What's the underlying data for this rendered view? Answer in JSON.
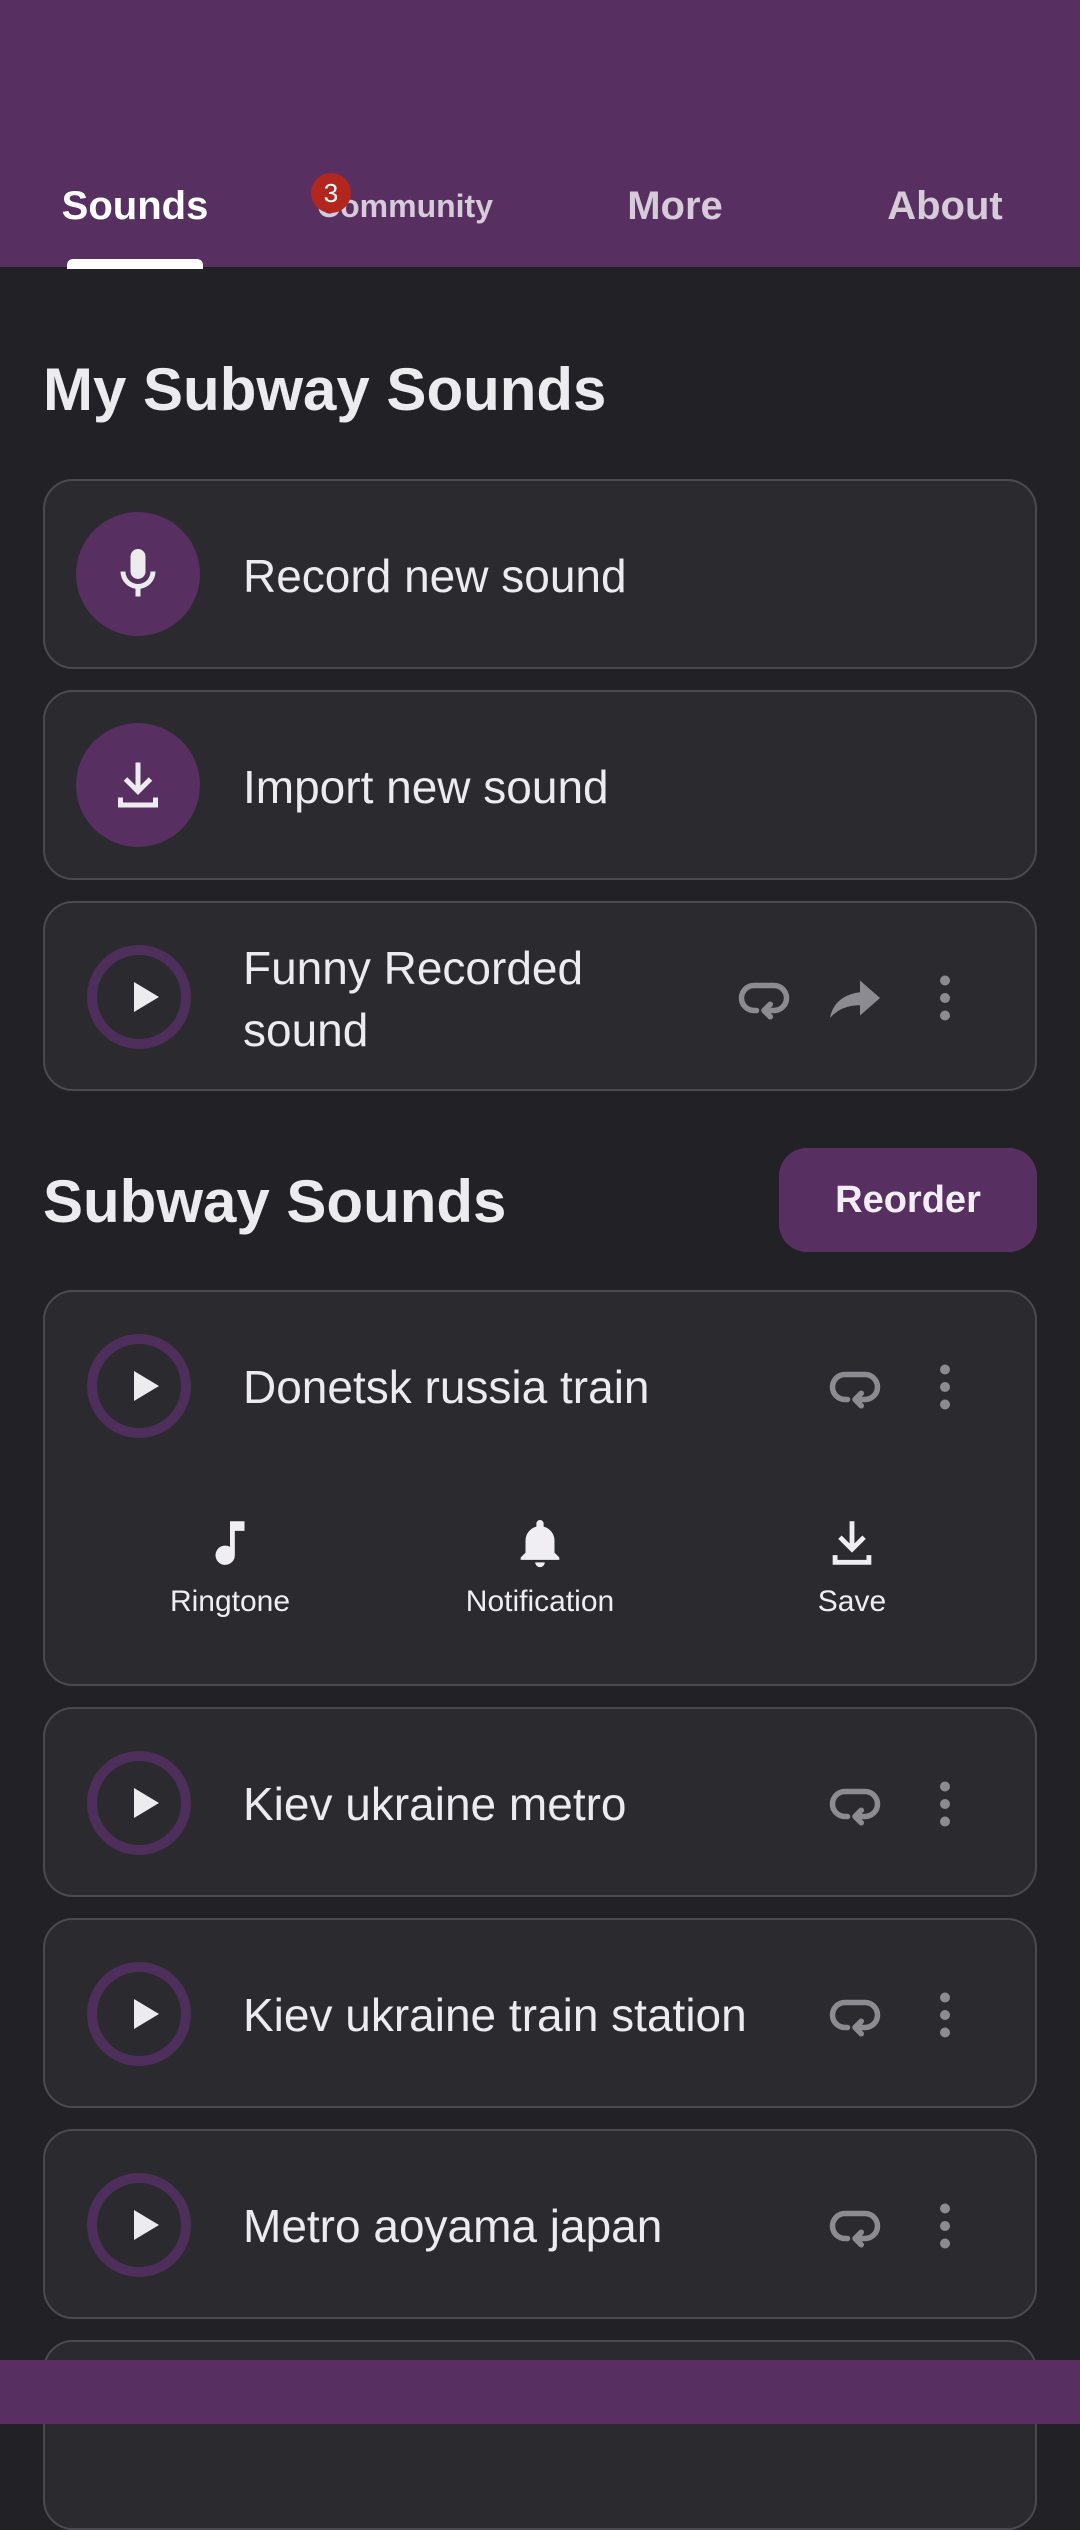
{
  "tabs": [
    {
      "label": "Sounds",
      "active": true
    },
    {
      "label": "Community",
      "badge": "3"
    },
    {
      "label": "More"
    },
    {
      "label": "About"
    }
  ],
  "my_sounds": {
    "title": "My Subway Sounds",
    "record_label": "Record new sound",
    "import_label": "Import new sound",
    "items": [
      {
        "title": "Funny Recorded sound"
      }
    ]
  },
  "subway_sounds": {
    "title": "Subway Sounds",
    "reorder_label": "Reorder",
    "expanded_item": {
      "title": "Donetsk russia train",
      "actions": {
        "ringtone": "Ringtone",
        "notification": "Notification",
        "save": "Save"
      }
    },
    "items": [
      {
        "title": "Kiev ukraine metro"
      },
      {
        "title": "Kiev ukraine train station"
      },
      {
        "title": "Metro aoyama japan"
      }
    ]
  },
  "colors": {
    "accent": "#572f61",
    "background": "#222226",
    "card": "#2a2a2f",
    "badge": "#b3261e"
  },
  "icons": [
    "microphone-icon",
    "download-icon",
    "play-icon",
    "loop-icon",
    "share-icon",
    "more-vert-icon",
    "music-note-icon",
    "bell-icon"
  ]
}
